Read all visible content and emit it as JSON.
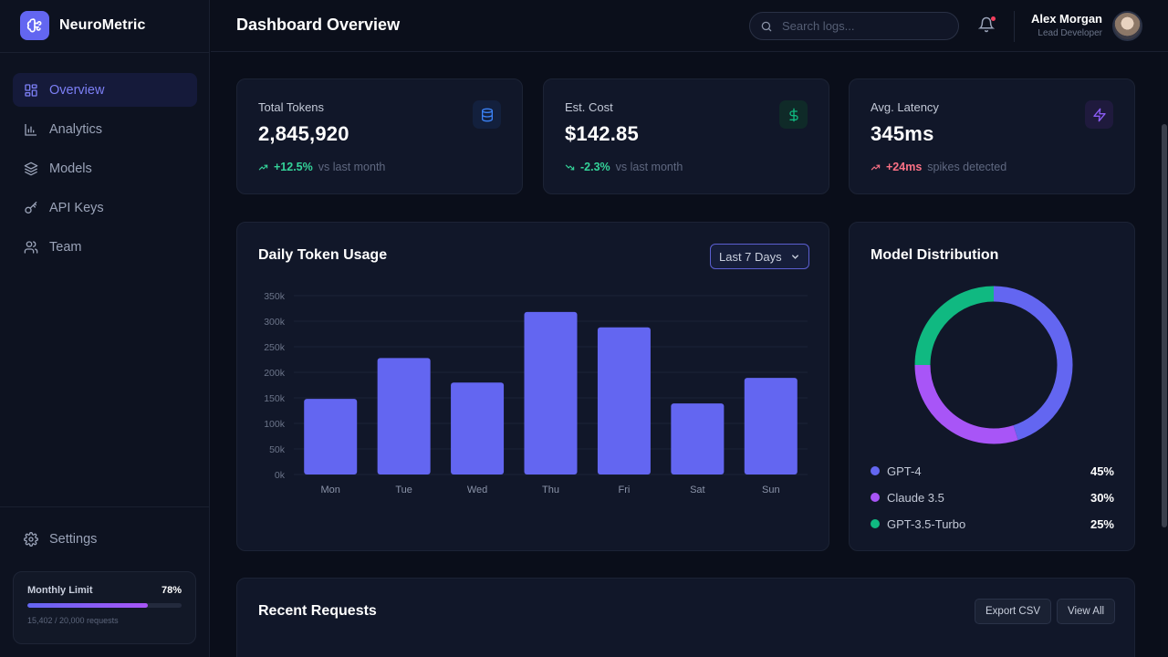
{
  "app": {
    "name": "NeuroMetric"
  },
  "sidebar": {
    "items": [
      {
        "label": "Overview",
        "icon": "grid-icon",
        "active": true
      },
      {
        "label": "Analytics",
        "icon": "bar-chart-icon",
        "active": false
      },
      {
        "label": "Models",
        "icon": "layers-icon",
        "active": false
      },
      {
        "label": "API Keys",
        "icon": "key-icon",
        "active": false
      },
      {
        "label": "Team",
        "icon": "users-icon",
        "active": false
      }
    ],
    "settings_label": "Settings",
    "monthly_limit": {
      "label": "Monthly Limit",
      "percent_text": "78%",
      "fraction": 0.78,
      "sub": "15,402 / 20,000 requests"
    }
  },
  "header": {
    "title": "Dashboard Overview",
    "search_placeholder": "Search logs...",
    "user": {
      "name": "Alex Morgan",
      "role": "Lead Developer"
    }
  },
  "stats": [
    {
      "label": "Total Tokens",
      "value": "2,845,920",
      "icon": "database-icon",
      "trend": "+12.5%",
      "note": "vs last month",
      "trend_color": "#34d399",
      "accent": "#3b82f6"
    },
    {
      "label": "Est. Cost",
      "value": "$142.85",
      "icon": "dollar-icon",
      "trend": "-2.3%",
      "note": "vs last month",
      "trend_color": "#34d399",
      "accent": "#10b981"
    },
    {
      "label": "Avg. Latency",
      "value": "345ms",
      "icon": "zap-icon",
      "trend": "+24ms",
      "note": "spikes detected",
      "trend_color": "#fb7185",
      "accent": "#8b5cf6"
    }
  ],
  "token_usage": {
    "title": "Daily Token Usage",
    "range_selected": "Last 7 Days"
  },
  "distribution": {
    "title": "Model Distribution"
  },
  "recent_requests": {
    "title": "Recent Requests",
    "export_label": "Export CSV",
    "view_all_label": "View All"
  },
  "chart_data": [
    {
      "type": "bar",
      "title": "Daily Token Usage",
      "categories": [
        "Mon",
        "Tue",
        "Wed",
        "Thu",
        "Fri",
        "Sat",
        "Sun"
      ],
      "values": [
        148000,
        228000,
        180000,
        318000,
        288000,
        139000,
        189000
      ],
      "ylim": [
        0,
        350000
      ],
      "yticks": [
        0,
        50000,
        100000,
        150000,
        200000,
        250000,
        300000,
        350000
      ],
      "ytick_labels": [
        "0k",
        "50k",
        "100k",
        "150k",
        "200k",
        "250k",
        "300k",
        "350k"
      ],
      "color": "#6366f1",
      "grid": true
    },
    {
      "type": "pie",
      "title": "Model Distribution",
      "donut": true,
      "labels": [
        "GPT-4",
        "Claude 3.5",
        "GPT-3.5-Turbo"
      ],
      "values": [
        45,
        30,
        25
      ],
      "value_labels": [
        "45%",
        "30%",
        "25%"
      ],
      "colors": [
        "#6366f1",
        "#a855f7",
        "#10b981"
      ],
      "legend": "bottom"
    }
  ]
}
